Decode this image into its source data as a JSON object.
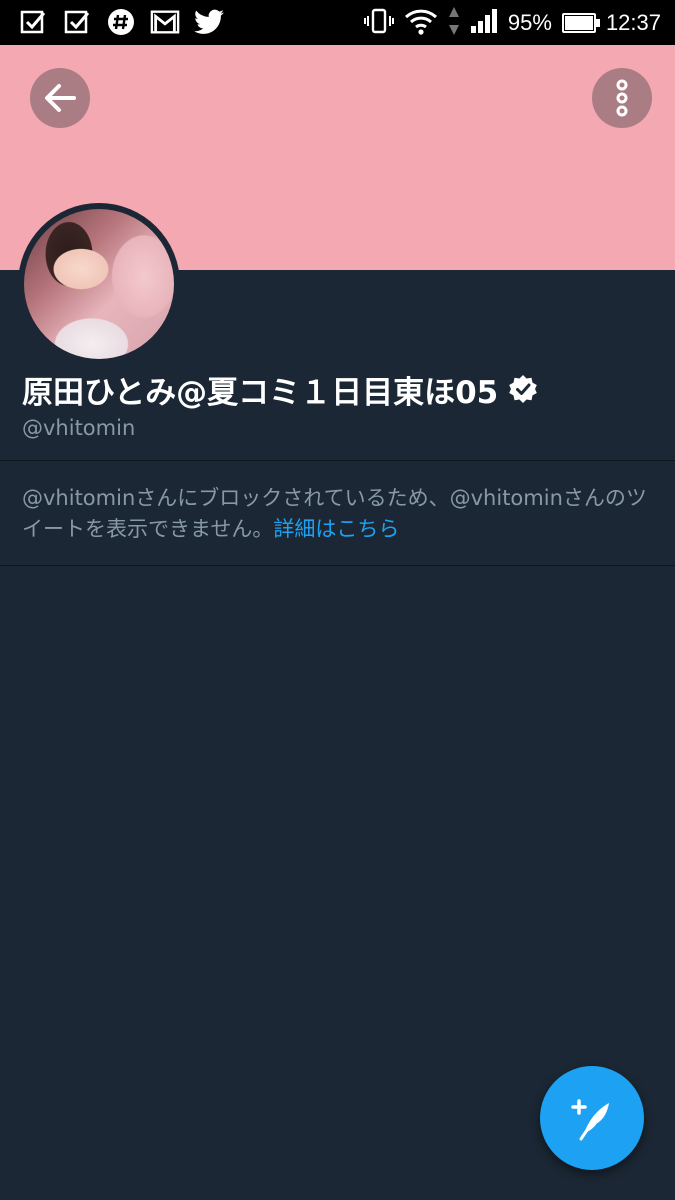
{
  "status_bar": {
    "left_icons": [
      "checkbox-icon",
      "checkbox-icon",
      "slack-icon",
      "gmail-icon",
      "twitter-icon"
    ],
    "battery_percent_label": "95%",
    "battery_level": 0.95,
    "time": "12:37"
  },
  "profile": {
    "banner_color": "#f4a8b2",
    "display_name": "原田ひとみ@夏コミ１日目東ほ05",
    "verified": true,
    "handle": "@vhitomin"
  },
  "blocked_notice": {
    "message": "@vhitominさんにブロックされているため、@vhitominさんのツイートを表示できません。",
    "link_text": "詳細はこちら"
  },
  "colors": {
    "background": "#1b2734",
    "accent": "#1da1f2",
    "secondary_text": "#8899a6"
  }
}
